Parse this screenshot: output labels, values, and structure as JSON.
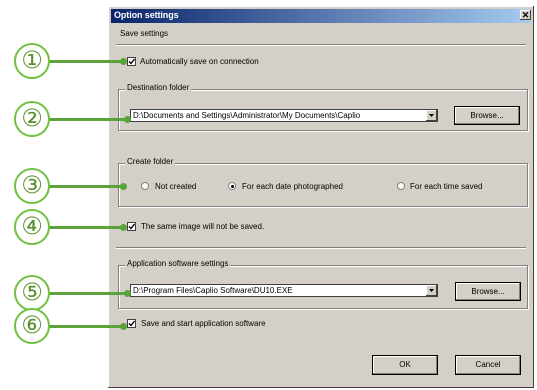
{
  "dialog": {
    "title": "Option settings",
    "close_glyph": "✕"
  },
  "save_settings": {
    "header": "Save settings",
    "auto_save": {
      "label": "Automatically save on connection",
      "checked": true
    },
    "destination": {
      "header": "Destination folder",
      "path": "D:\\Documents and Settings\\Administrator\\My Documents\\Caplio",
      "browse_label": "Browse..."
    },
    "create_folder": {
      "header": "Create folder",
      "options": [
        {
          "label": "Not created",
          "selected": false
        },
        {
          "label": "For each date photographed",
          "selected": true
        },
        {
          "label": "For each time saved",
          "selected": false
        }
      ]
    },
    "no_duplicate": {
      "label": "The same image will not be saved.",
      "checked": true
    }
  },
  "app_settings": {
    "header": "Application software settings",
    "path": "D:\\Program Files\\Caplio Software\\DU10.EXE",
    "browse_label": "Browse...",
    "save_and_start": {
      "label": "Save and start application software",
      "checked": true
    }
  },
  "footer": {
    "ok_label": "OK",
    "cancel_label": "Cancel"
  },
  "callouts": [
    "①",
    "②",
    "③",
    "④",
    "⑤",
    "⑥"
  ],
  "colors": {
    "callout_green": "#5aa33a",
    "title_bar": "#0a246a",
    "dialog_face": "#d4d0c8"
  }
}
